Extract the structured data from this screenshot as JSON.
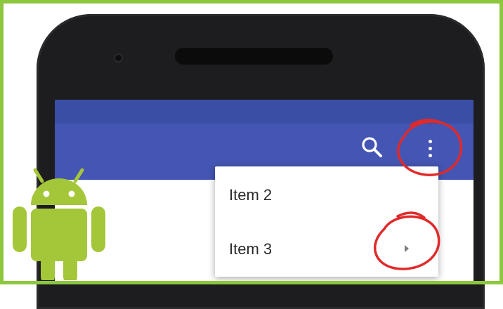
{
  "app_bar": {
    "actions": [
      {
        "name": "search",
        "icon": "search-icon"
      },
      {
        "name": "more-options",
        "icon": "more-vert-icon"
      }
    ],
    "color": "#4555b3",
    "status_bar_color": "#3a4ea6"
  },
  "overflow_menu": {
    "items": [
      {
        "label": "Item 2",
        "has_submenu": false
      },
      {
        "label": "Item 3",
        "has_submenu": true
      }
    ]
  },
  "colors": {
    "frame": "#8dc63f",
    "android": "#a4c639",
    "annotation": "#e02a2a"
  },
  "logo": {
    "icon": "android-robot-icon"
  }
}
